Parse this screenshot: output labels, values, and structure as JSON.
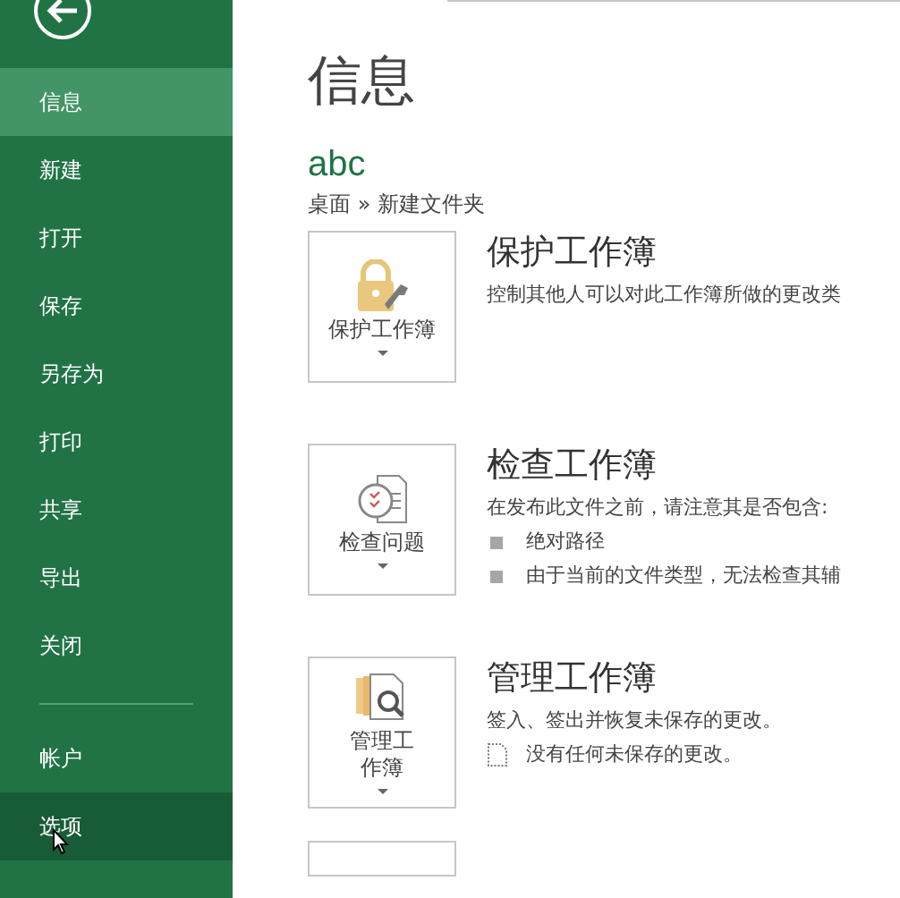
{
  "sidebar": {
    "items": [
      {
        "label": "信息",
        "selected": true,
        "hovered": false
      },
      {
        "label": "新建",
        "selected": false,
        "hovered": false
      },
      {
        "label": "打开",
        "selected": false,
        "hovered": false
      },
      {
        "label": "保存",
        "selected": false,
        "hovered": false
      },
      {
        "label": "另存为",
        "selected": false,
        "hovered": false
      },
      {
        "label": "打印",
        "selected": false,
        "hovered": false
      },
      {
        "label": "共享",
        "selected": false,
        "hovered": false
      },
      {
        "label": "导出",
        "selected": false,
        "hovered": false
      },
      {
        "label": "关闭",
        "selected": false,
        "hovered": false
      }
    ],
    "bottom_items": [
      {
        "label": "帐户",
        "selected": false,
        "hovered": false
      },
      {
        "label": "选项",
        "selected": false,
        "hovered": true
      }
    ]
  },
  "main": {
    "title": "信息",
    "file_name": "abc",
    "path": "桌面 » 新建文件夹",
    "sections": [
      {
        "kind": "protect",
        "button": "保护工作簿",
        "title": "保护工作簿",
        "description": "控制其他人可以对此工作簿所做的更改类"
      },
      {
        "kind": "inspect",
        "button": "检查问题",
        "title": "检查工作簿",
        "description": "在发布此文件之前，请注意其是否包含:",
        "bullets": [
          {
            "kind": "square",
            "text": "绝对路径"
          },
          {
            "kind": "square",
            "text": "由于当前的文件类型，无法检查其辅"
          }
        ]
      },
      {
        "kind": "manage",
        "button": "管理工作簿",
        "title": "管理工作簿",
        "description": "签入、签出并恢复未保存的更改。",
        "bullets": [
          {
            "kind": "doc",
            "text": "没有任何未保存的更改。"
          }
        ]
      }
    ]
  }
}
